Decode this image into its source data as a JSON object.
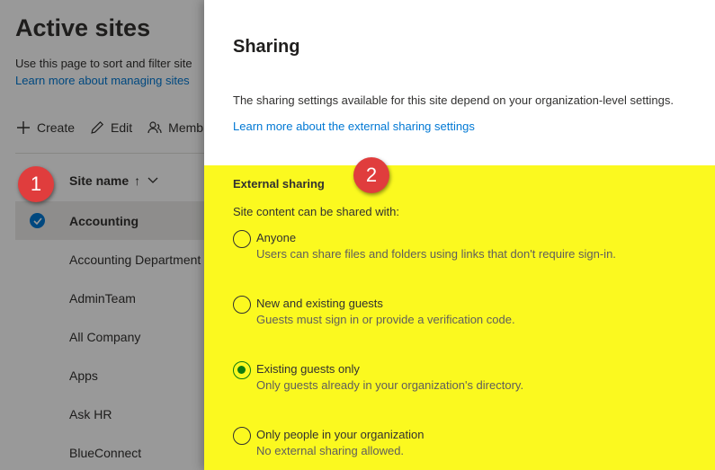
{
  "background": {
    "title": "Active sites",
    "description": "Use this page to sort and filter site",
    "learn_link": "Learn more about managing sites",
    "commands": [
      {
        "label": "Create",
        "icon": "plus-icon"
      },
      {
        "label": "Edit",
        "icon": "pencil-icon"
      },
      {
        "label": "Memb",
        "icon": "people-icon"
      }
    ],
    "column_header": "Site name",
    "sort_indicator": "↑",
    "sites": [
      "Accounting",
      "Accounting Department",
      "AdminTeam",
      "All Company",
      "Apps",
      "Ask HR",
      "BlueConnect"
    ]
  },
  "badges": [
    "1",
    "2"
  ],
  "panel": {
    "title": "Sharing",
    "description": "The sharing settings available for this site depend on your organization-level settings.",
    "learn_link": "Learn more about the external sharing settings",
    "section_title": "External sharing",
    "section_subtitle": "Site content can be shared with:",
    "options": [
      {
        "label": "Anyone",
        "help": "Users can share files and folders using links that don't require sign-in.",
        "selected": false
      },
      {
        "label": "New and existing guests",
        "help": "Guests must sign in or provide a verification code.",
        "selected": false
      },
      {
        "label": "Existing guests only",
        "help": "Only guests already in your organization's directory.",
        "selected": true
      },
      {
        "label": "Only people in your organization",
        "help": "No external sharing allowed.",
        "selected": false
      }
    ]
  },
  "colors": {
    "accent": "#0078d4",
    "highlight": "#fbf91f",
    "badge": "#e03d3d",
    "radio_selected": "#107c10"
  }
}
